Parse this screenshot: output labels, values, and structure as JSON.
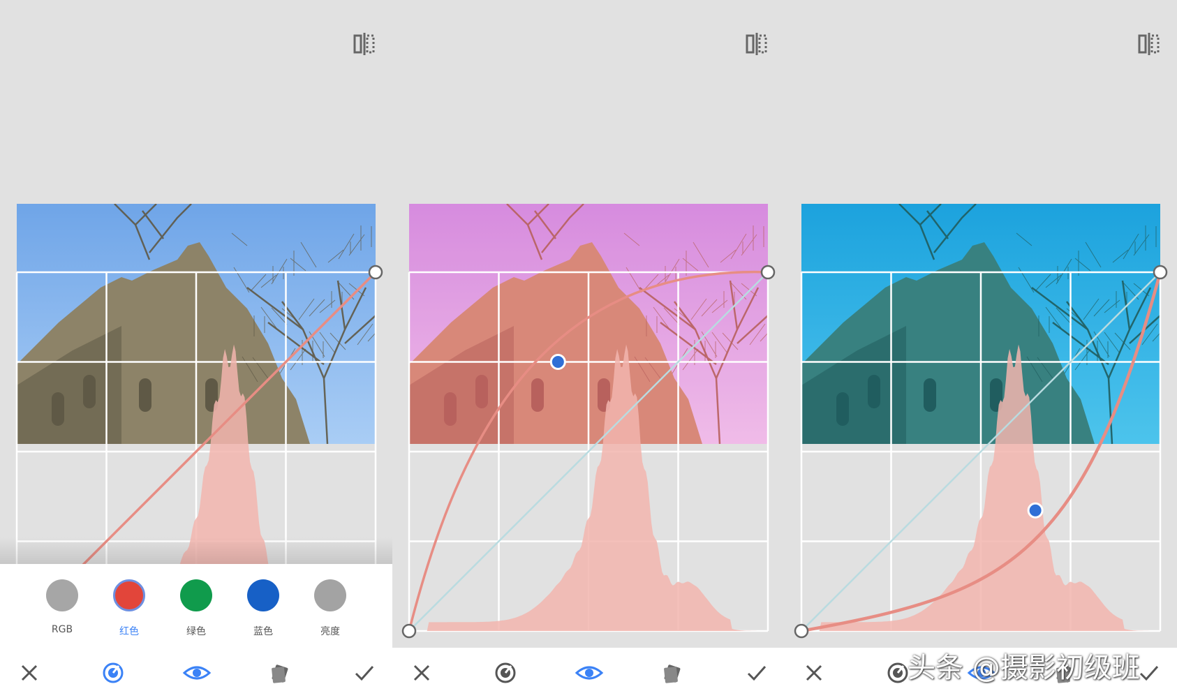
{
  "panels": [
    {
      "id": "original",
      "photo_tint": {
        "sky_top": "#6fa5e8",
        "sky_bottom": "#a9cdf5",
        "building": "#8d8368",
        "shade": "#5f5946",
        "overlay": "rgba(0,0,0,0)"
      }
    },
    {
      "id": "red-boost",
      "photo_tint": {
        "sky_top": "#d38ee6",
        "sky_bottom": "#efc2f0",
        "building": "#d58a78",
        "shade": "#b2605a",
        "overlay": "rgba(255,120,140,0.08)"
      }
    },
    {
      "id": "red-reduce",
      "photo_tint": {
        "sky_top": "#1ea2df",
        "sky_bottom": "#51c5ef",
        "building": "#3c7f7d",
        "shade": "#22595a",
        "overlay": "rgba(0,180,200,0.05)"
      }
    }
  ],
  "channel_picker": {
    "selected": "red",
    "channels": [
      {
        "key": "rgb",
        "label": "RGB",
        "color": "#a6a6a6"
      },
      {
        "key": "red",
        "label": "红色",
        "color": "#e2453a"
      },
      {
        "key": "green",
        "label": "绿色",
        "color": "#109b4c"
      },
      {
        "key": "blue",
        "label": "蓝色",
        "color": "#1760c6"
      },
      {
        "key": "brightness",
        "label": "亮度",
        "color": "#a3a3a3"
      }
    ]
  },
  "toolbar": {
    "icons": [
      "close-icon",
      "color-picker-icon",
      "eye-icon",
      "presets-icon",
      "checkmark-icon"
    ]
  },
  "colors": {
    "curve": "#e78d84",
    "identity_line": "#b9dbe0",
    "histogram": "#f2b5ae",
    "active_point": "#2f6fd6",
    "accent": "#3b82f6"
  },
  "watermark": "头条 @摄影初级班"
}
